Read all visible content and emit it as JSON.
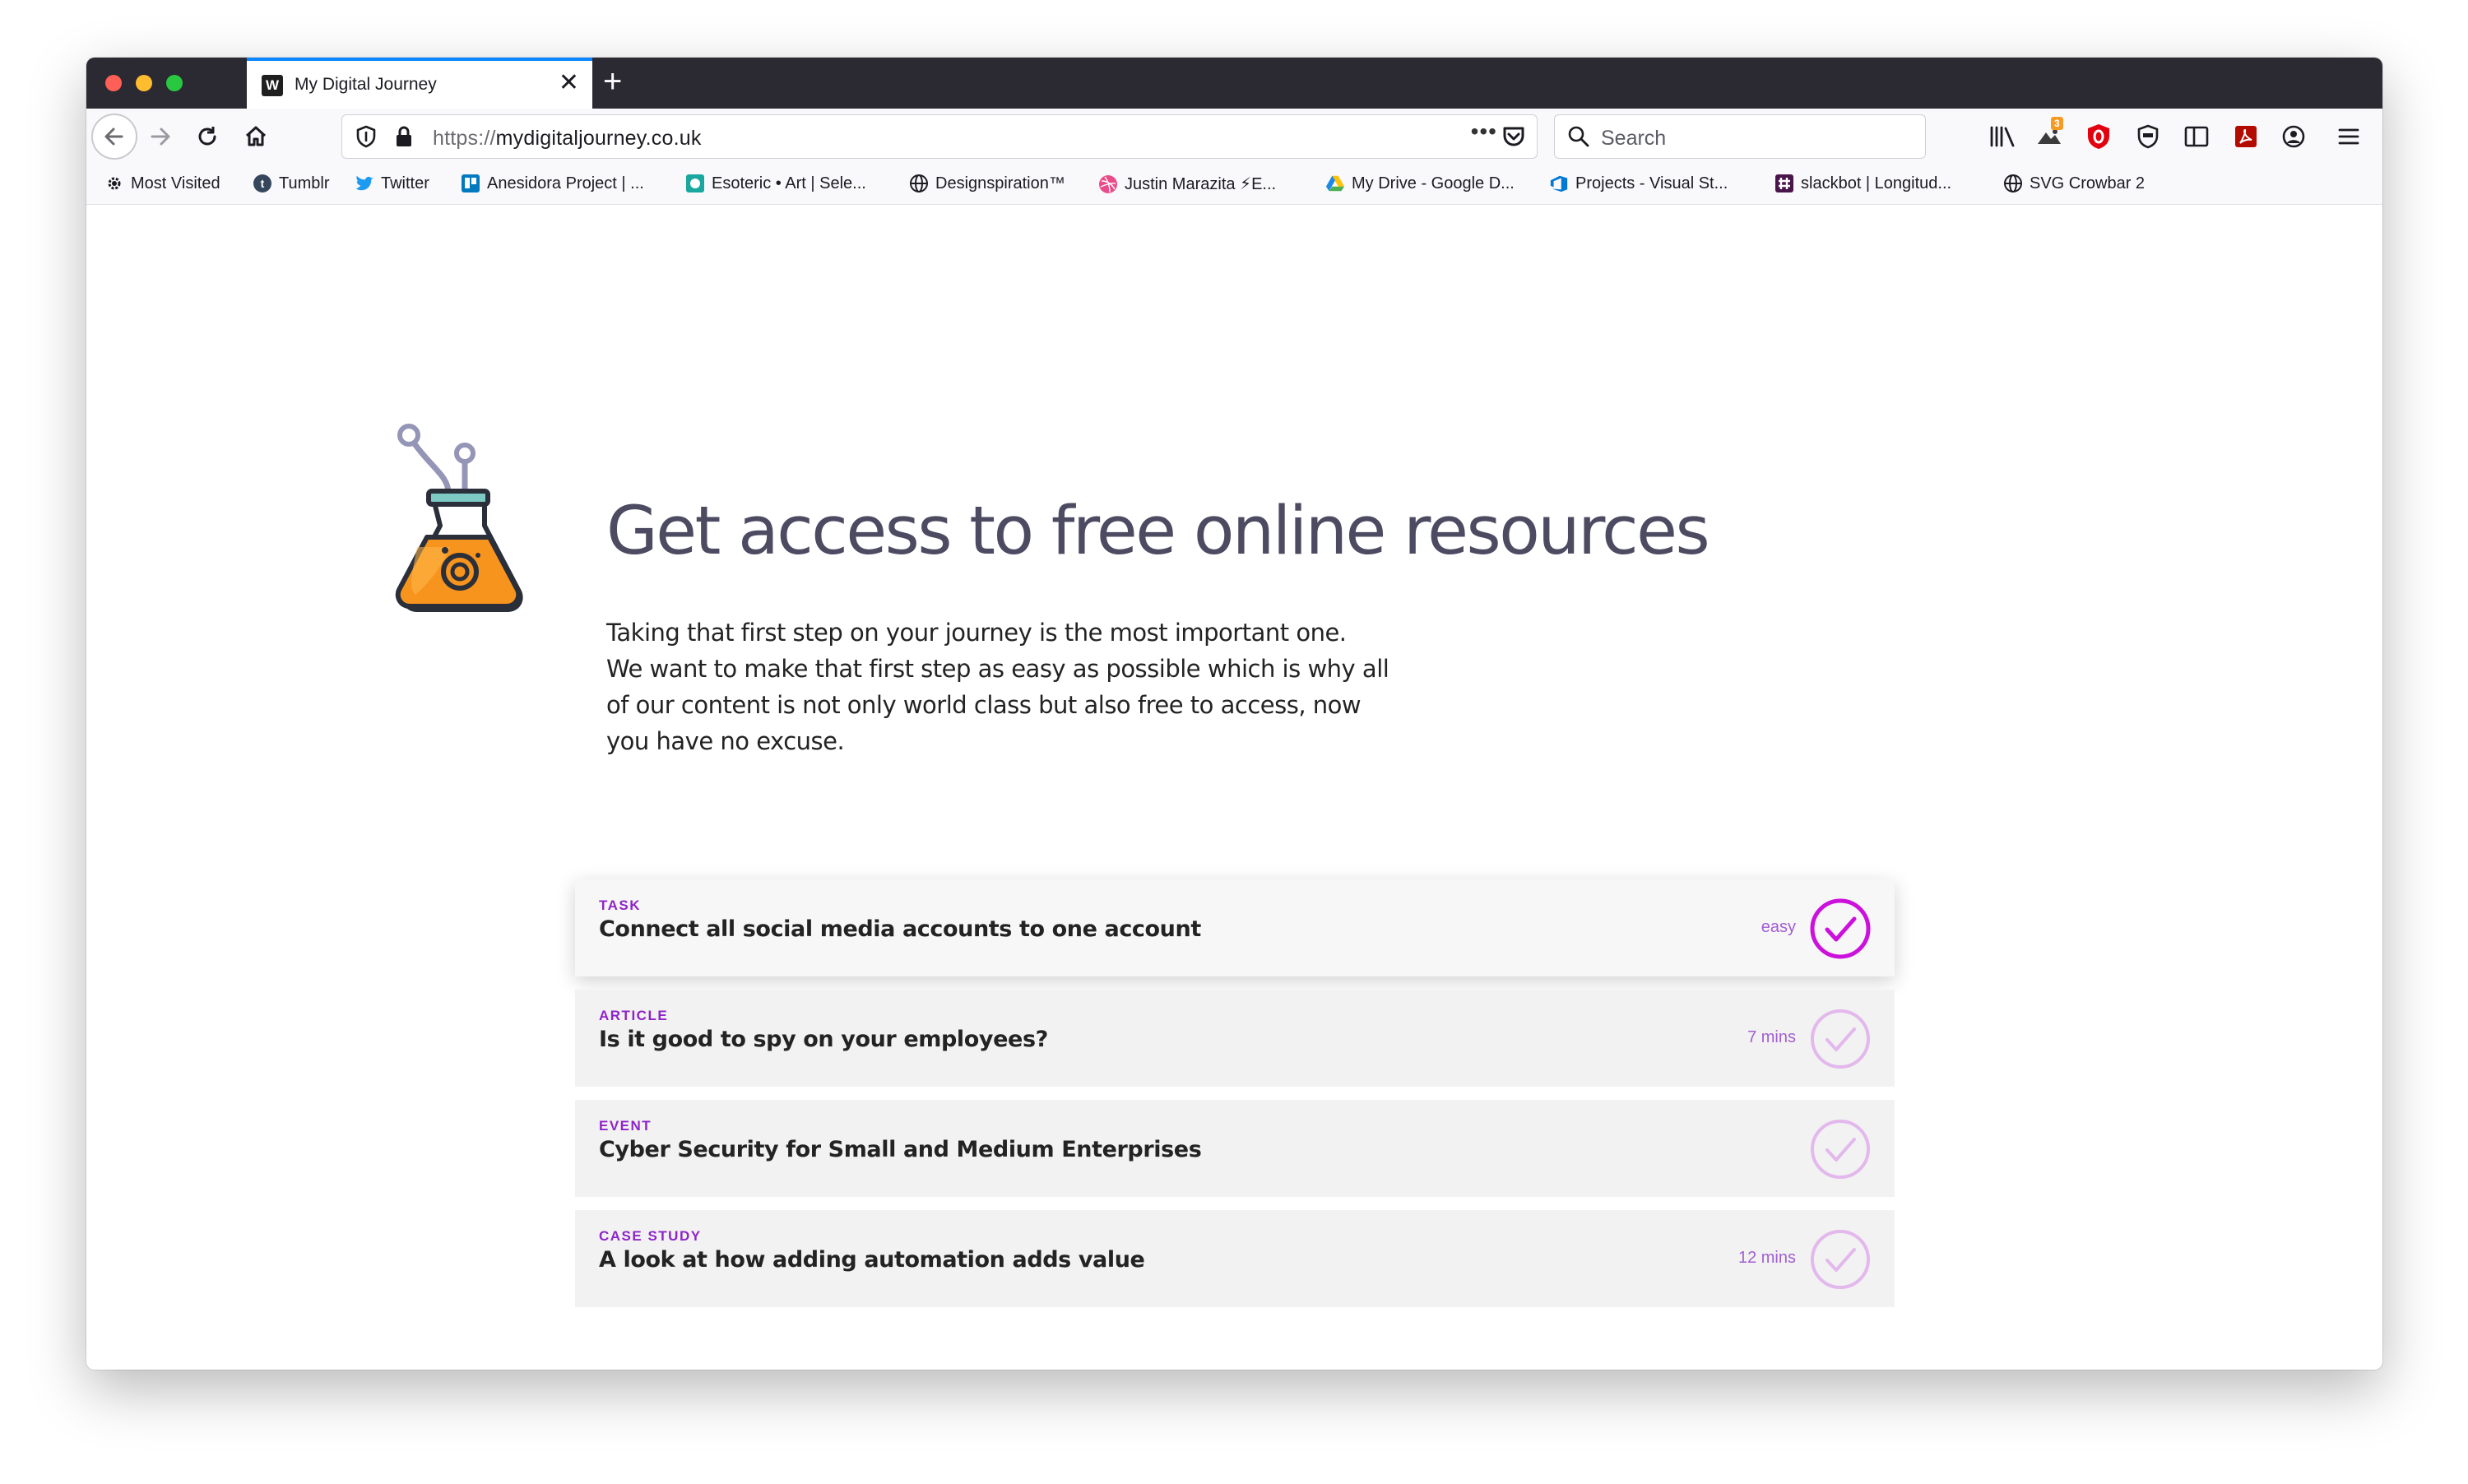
{
  "browser": {
    "tab": {
      "favicon_letter": "W",
      "title": "My Digital Journey",
      "close_glyph": "✕"
    },
    "new_tab_glyph": "+",
    "url": {
      "scheme": "https://",
      "host": "mydigitaljourney.co.uk"
    },
    "url_more_glyph": "•••",
    "search_placeholder": "Search",
    "extension_badge": "3",
    "bookmarks": [
      {
        "label": "Most Visited",
        "icon": "gear-icon"
      },
      {
        "label": "Tumblr",
        "icon": "tumblr-icon"
      },
      {
        "label": "Twitter",
        "icon": "twitter-icon"
      },
      {
        "label": "Anesidora Project | ...",
        "icon": "trello-icon"
      },
      {
        "label": "Esoteric • Art | Sele...",
        "icon": "esoteric-icon"
      },
      {
        "label": "Designspiration™",
        "icon": "globe-icon"
      },
      {
        "label": "Justin Marazita ⚡E...",
        "icon": "dribbble-icon"
      },
      {
        "label": "My Drive - Google D...",
        "icon": "google-drive-icon"
      },
      {
        "label": "Projects - Visual St...",
        "icon": "azure-devops-icon"
      },
      {
        "label": "slackbot | Longitud...",
        "icon": "slack-icon"
      },
      {
        "label": "SVG Crowbar 2",
        "icon": "globe-icon"
      }
    ]
  },
  "page": {
    "headline": "Get access to free online resources",
    "intro_lines": [
      "Taking that first step on your journey is the most important one.",
      "We want to make that first step as easy as possible which is why all",
      "of our content is not only world class but also free to access, now",
      "you have no excuse."
    ],
    "cards": [
      {
        "category": "TASK",
        "title": "Connect all social media accounts to one account",
        "meta": "easy"
      },
      {
        "category": "ARTICLE",
        "title": "Is it good to spy on your employees?",
        "meta": "7 mins"
      },
      {
        "category": "EVENT",
        "title": "Cyber Security for Small and Medium Enterprises",
        "meta": ""
      },
      {
        "category": "CASE STUDY",
        "title": "A look at how adding automation adds value",
        "meta": "12 mins"
      }
    ]
  },
  "colors": {
    "accent_purple": "#8e24c9",
    "check_active": "#cc11dd",
    "check_inactive": "#e3b8ec",
    "headline": "#4d4b62",
    "card_bg": "#f2f2f2",
    "tab_strip": "#2b2a33"
  }
}
